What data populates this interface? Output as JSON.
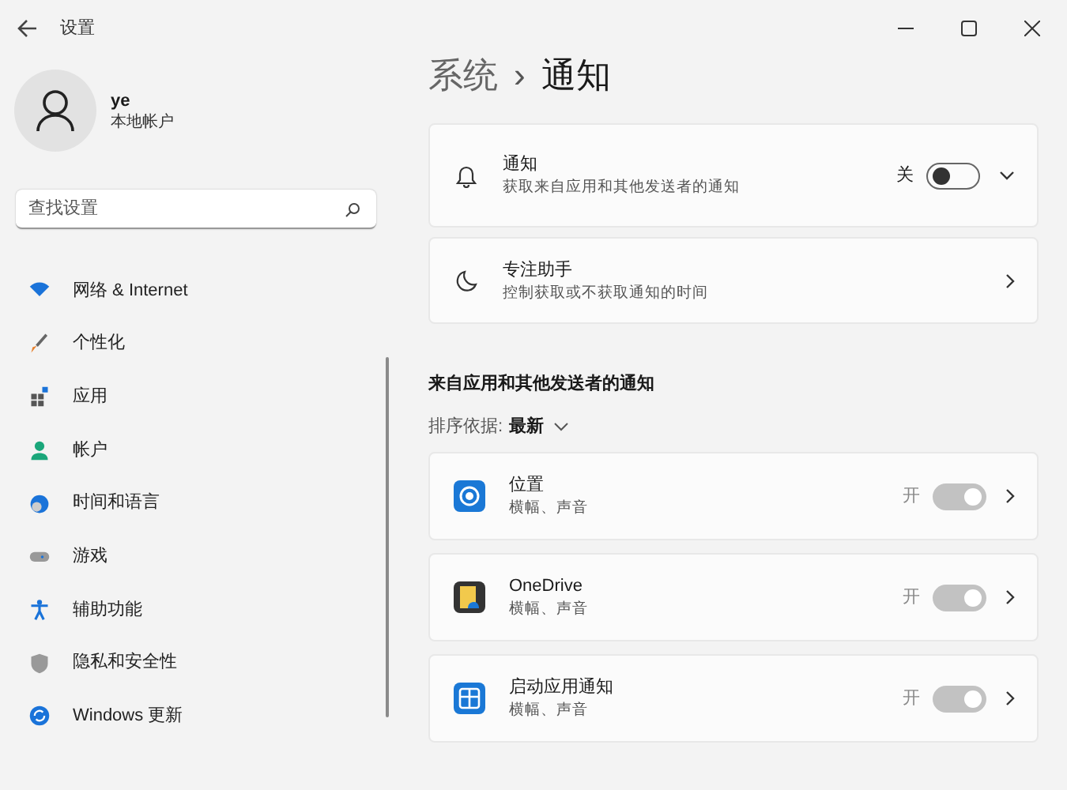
{
  "window": {
    "title": "设置"
  },
  "user": {
    "name": "ye",
    "account": "本地帐户"
  },
  "search": {
    "placeholder": "查找设置"
  },
  "nav": [
    {
      "label": "网络 & Internet"
    },
    {
      "label": "个性化"
    },
    {
      "label": "应用"
    },
    {
      "label": "帐户"
    },
    {
      "label": "时间和语言"
    },
    {
      "label": "游戏"
    },
    {
      "label": "辅助功能"
    },
    {
      "label": "隐私和安全性"
    },
    {
      "label": "Windows 更新"
    }
  ],
  "breadcrumb": {
    "parent": "系统",
    "separator": "›",
    "current": "通知"
  },
  "settings": [
    {
      "kind": "toggle",
      "title": "通知",
      "subtitle": "获取来自应用和其他发送者的通知",
      "state": "关",
      "on": false
    },
    {
      "kind": "link",
      "title": "专注助手",
      "subtitle": "控制获取或不获取通知的时间"
    }
  ],
  "apps_section": {
    "heading": "来自应用和其他发送者的通知",
    "sort_label": "排序依据:",
    "sort_value": "最新"
  },
  "apps": [
    {
      "title": "位置",
      "subtitle": "横幅、声音",
      "state": "开",
      "on": true,
      "disabled": true
    },
    {
      "title": "OneDrive",
      "subtitle": "横幅、声音",
      "state": "开",
      "on": true,
      "disabled": true
    },
    {
      "title": "启动应用通知",
      "subtitle": "横幅、声音",
      "state": "开",
      "on": true,
      "disabled": true
    }
  ]
}
